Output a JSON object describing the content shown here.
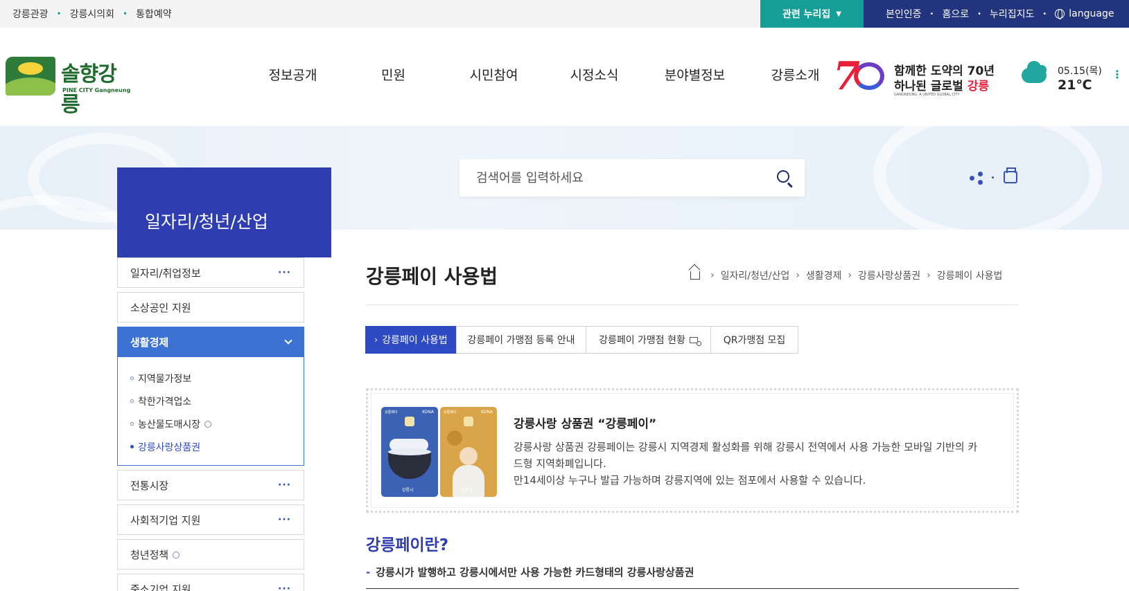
{
  "topbar": {
    "links": [
      "강릉관광",
      "강릉시의회",
      "통합예약"
    ],
    "related_label": "관련 누리집",
    "util_links": [
      "본인인증",
      "홈으로",
      "누리집지도"
    ],
    "language_label": "language"
  },
  "header": {
    "logo_text": "솔향강릉",
    "logo_sub": "PINE CITY Gangneung",
    "nav": [
      "정보공개",
      "민원",
      "시민참여",
      "시정소식",
      "분야별정보",
      "강릉소개"
    ],
    "anniversary": {
      "line1": "함께한 도약의 70년",
      "line2_prefix": "하나된 글로벌 ",
      "line2_highlight": "강릉",
      "line3": "GANGNEUNG, A UNITED GLOBAL CITY"
    },
    "weather": {
      "date": "05.15(목)",
      "temp": "21℃",
      "icon": "cloud-icon"
    }
  },
  "search": {
    "placeholder": "검색어를 입력하세요"
  },
  "sidenav": {
    "title": "일자리/청년/산업",
    "items": [
      {
        "label": "일자리/취업정보",
        "more": "···"
      },
      {
        "label": "소상공인 지원"
      },
      {
        "label": "생활경제"
      },
      {
        "label": "전통시장",
        "more": "···"
      },
      {
        "label": "사회적기업 지원",
        "more": "···"
      },
      {
        "label": "청년정책"
      },
      {
        "label": "중소기업 지원",
        "more": "···"
      }
    ],
    "sub_items": [
      "지역물가정보",
      "착한가격업소",
      "농산물도매시장",
      "강릉사랑상품권"
    ]
  },
  "content": {
    "title": "강릉페이 사용법",
    "breadcrumb": [
      "일자리/청년/산업",
      "생활경제",
      "강릉사랑상품권",
      "강릉페이 사용법"
    ],
    "tabs": [
      "강릉페이 사용법",
      "강릉페이 가맹점 등록 안내",
      "강릉페이 가맹점 현황",
      "QR가맹점 모집"
    ],
    "intro": {
      "title": "강릉사랑 상품권 “강릉페이”",
      "text1": "강릉사랑 상품권 강릉페이는 강릉시 지역경제 활성화를 위해 강릉시 전역에서 사용 가능한 모바일 기반의 카드형 지역화폐입니다.",
      "text2": "만14세이상 누구나 발급 가능하며 강릉지역에 있는 점포에서 사용할 수 있습니다.",
      "card_brand": "KONA",
      "card_name": "강릉페이",
      "card_city": "강릉시"
    },
    "section_title": "강릉페이란?",
    "section_sub": "강릉시가 발행하고 강릉시에서만 사용 가능한 카드형태의 강릉사랑상품권"
  },
  "colors": {
    "primary_blue": "#2e3db0",
    "teal": "#159e98",
    "navy": "#23347f",
    "active_blue": "#3c72d1"
  }
}
